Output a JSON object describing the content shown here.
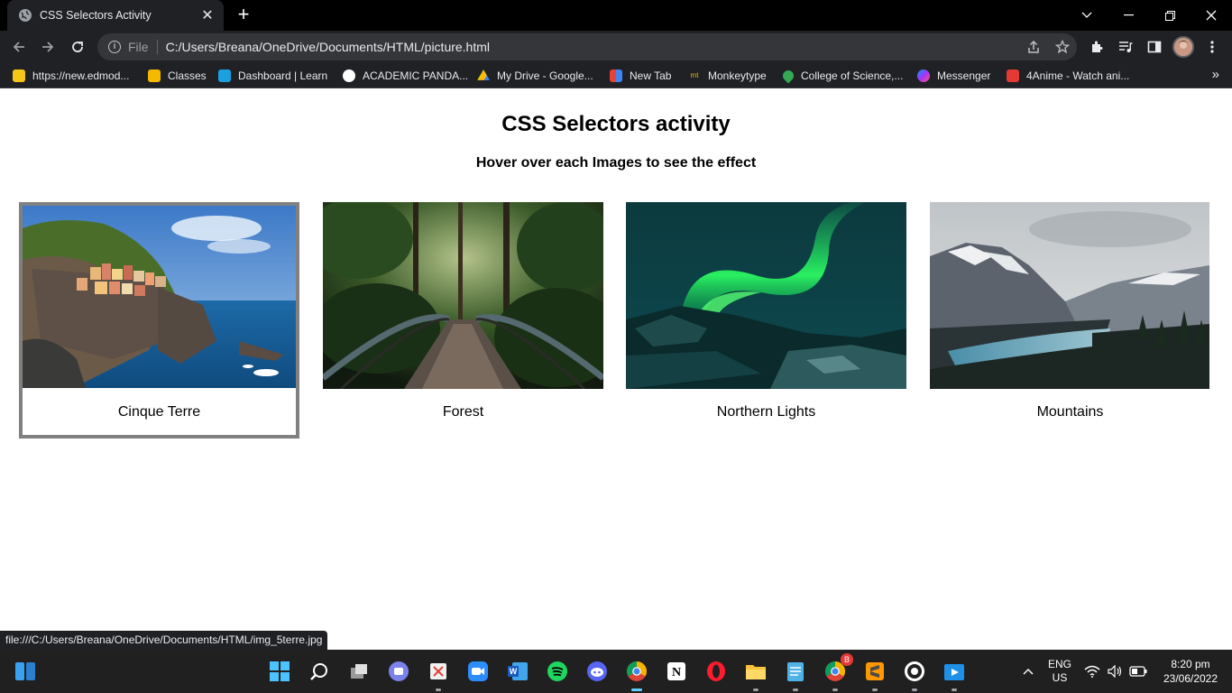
{
  "browser": {
    "tab_title": "CSS Selectors Activity",
    "scheme_label": "File",
    "url": "C:/Users/Breana/OneDrive/Documents/HTML/picture.html",
    "bookmarks": [
      {
        "label": "https://new.edmod...",
        "color": "#f5c518"
      },
      {
        "label": "Classes",
        "color": "#f6b900"
      },
      {
        "label": "Dashboard | Learn",
        "color": "#1ba1e2"
      },
      {
        "label": "ACADEMIC PANDA...",
        "color": "#ffffff"
      },
      {
        "label": "My Drive - Google...",
        "color": "#34a853"
      },
      {
        "label": "New Tab",
        "color": "#e94235"
      },
      {
        "label": "Monkeytype",
        "color": "#e2b714"
      },
      {
        "label": "College of Science,...",
        "color": "#ea4335"
      },
      {
        "label": "Messenger",
        "color": "#a334fa"
      },
      {
        "label": "4Anime - Watch ani...",
        "color": "#e53935"
      }
    ],
    "more_bookmarks": "»",
    "status_url": "file:///C:/Users/Breana/OneDrive/Documents/HTML/img_5terre.jpg"
  },
  "page": {
    "heading": "CSS Selectors activity",
    "subheading": "Hover over each Images to see the effect",
    "gallery": [
      {
        "caption": "Cinque Terre",
        "image": "cinque-terre-coastal-village",
        "hovered": true
      },
      {
        "caption": "Forest",
        "image": "forest-bridge",
        "hovered": false
      },
      {
        "caption": "Northern Lights",
        "image": "aurora-borealis",
        "hovered": false
      },
      {
        "caption": "Mountains",
        "image": "mountain-lake",
        "hovered": false
      }
    ]
  },
  "taskbar": {
    "language": "ENG",
    "region": "US",
    "time": "8:20 pm",
    "date": "23/06/2022",
    "chrome_badge": "B"
  }
}
